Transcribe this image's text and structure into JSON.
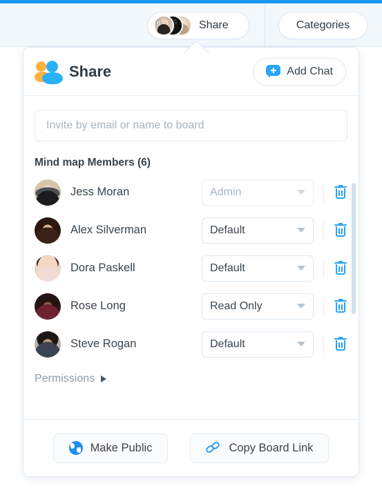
{
  "toolbar": {
    "share_button": {
      "label": "Share",
      "avatar_count": "6",
      "icon": "avatar-stack"
    },
    "categories_button": {
      "label": "Categories"
    }
  },
  "panel": {
    "title": "Share",
    "title_icon": "people-icon",
    "add_chat": {
      "label": "Add Chat",
      "icon": "chat-plus-icon"
    },
    "invite": {
      "value": "",
      "placeholder": "Invite by email or name to board"
    },
    "members_heading": "Mind map Members (6)",
    "members": [
      {
        "name": "Jess Moran",
        "role": "Admin",
        "role_disabled": true,
        "delete_icon": "trash-icon"
      },
      {
        "name": "Alex Silverman",
        "role": "Default",
        "role_disabled": false,
        "delete_icon": "trash-icon"
      },
      {
        "name": "Dora Paskell",
        "role": "Default",
        "role_disabled": false,
        "delete_icon": "trash-icon"
      },
      {
        "name": "Rose Long",
        "role": "Read Only",
        "role_disabled": false,
        "delete_icon": "trash-icon"
      },
      {
        "name": "Steve Rogan",
        "role": "Default",
        "role_disabled": false,
        "delete_icon": "trash-icon"
      }
    ],
    "role_options": [
      "Admin",
      "Default",
      "Read Only"
    ],
    "permissions_link": "Permissions",
    "footer": {
      "make_public": {
        "label": "Make Public",
        "icon": "globe-icon"
      },
      "copy_link": {
        "label": "Copy Board Link",
        "icon": "link-icon"
      }
    }
  },
  "colors": {
    "accent_blue": "#1b97f7",
    "icon_blue": "#29a3f7",
    "icon_orange": "#ffb23e",
    "text_dark": "#3a444c",
    "text_muted": "#a8b4bd",
    "toolbar_bg": "#f3f8fc",
    "border": "#dfe9f1"
  }
}
